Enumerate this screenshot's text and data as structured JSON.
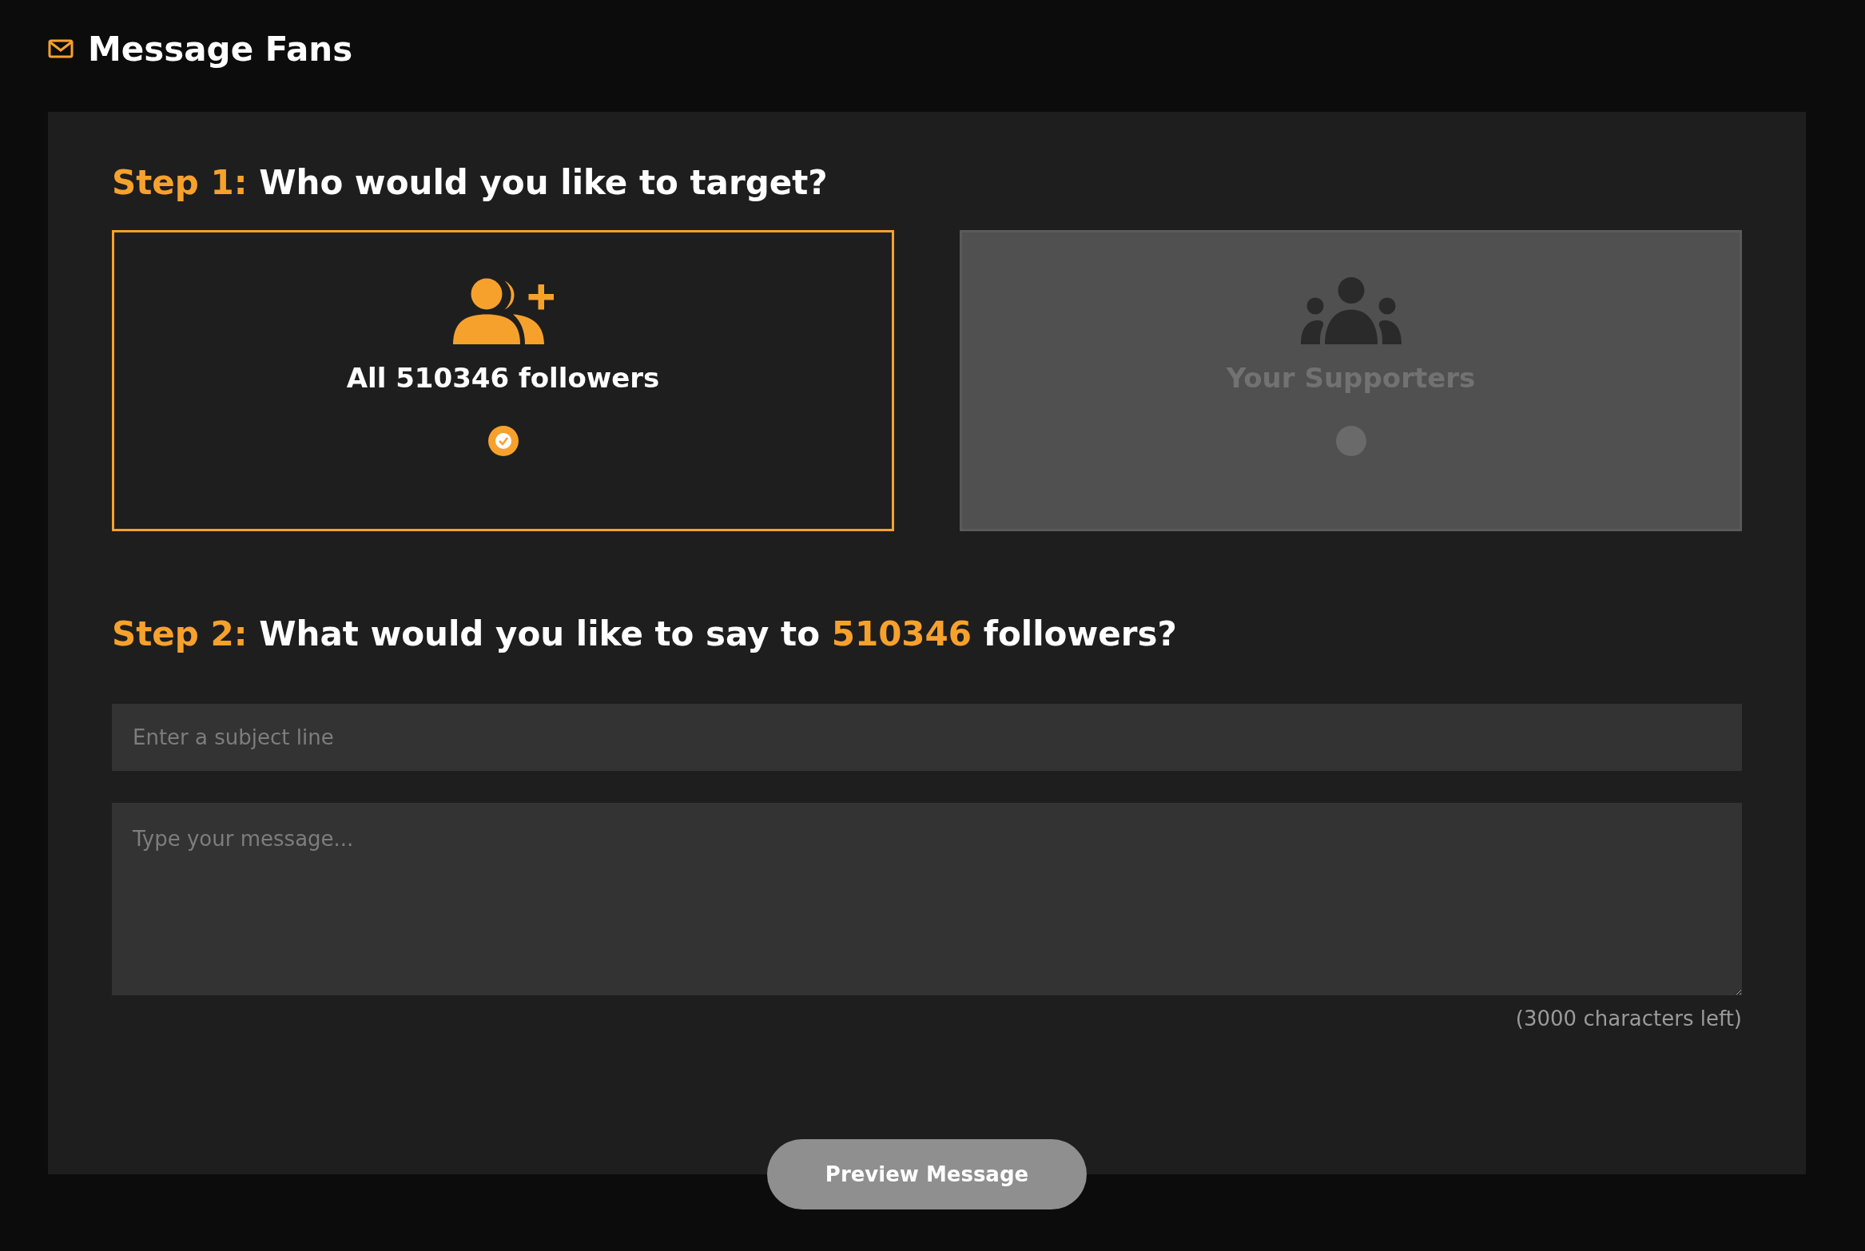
{
  "header": {
    "title": "Message Fans"
  },
  "step1": {
    "label": "Step 1:",
    "question": "Who would you like to target?"
  },
  "targets": [
    {
      "kind": "all",
      "label": "All 510346 followers",
      "selected": true
    },
    {
      "kind": "supporters",
      "label": "Your Supporters",
      "selected": false
    }
  ],
  "step2": {
    "label": "Step 2:",
    "question_before": "What would you like to say to",
    "count": "510346",
    "question_after": "followers?"
  },
  "subject": {
    "placeholder": "Enter a subject line"
  },
  "message": {
    "placeholder": "Type your message..."
  },
  "chars_left": "(3000 characters left)",
  "button": "Preview Message"
}
